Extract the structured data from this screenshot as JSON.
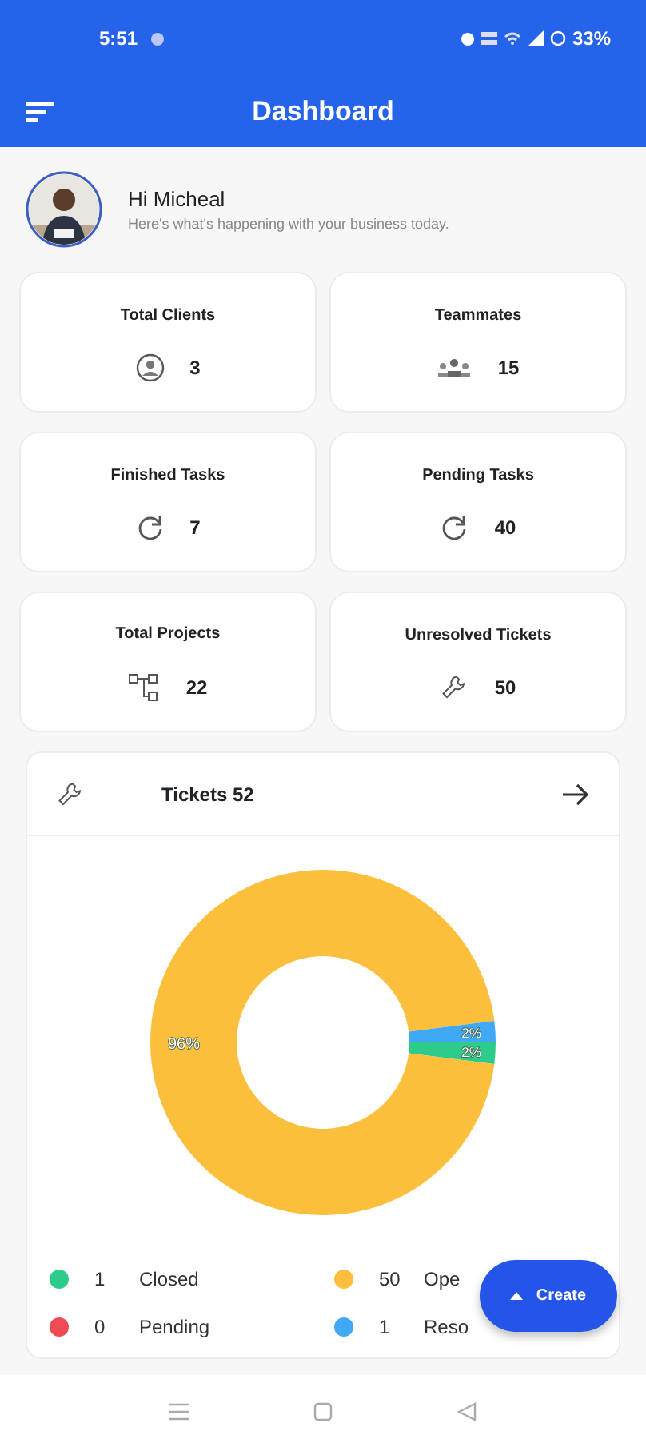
{
  "status_bar": {
    "time": "5:51",
    "battery": "33%"
  },
  "app_bar": {
    "title": "Dashboard"
  },
  "greeting": {
    "title": "Hi Micheal",
    "subtitle": "Here's what's happening with your business today."
  },
  "stats": [
    {
      "label": "Total Clients",
      "value": "3",
      "kind": "person"
    },
    {
      "label": "Teammates",
      "value": "15",
      "kind": "group"
    },
    {
      "label": "Finished Tasks",
      "value": "7",
      "kind": "refresh"
    },
    {
      "label": "Pending Tasks",
      "value": "40",
      "kind": "refresh"
    },
    {
      "label": "Total Projects",
      "value": "22",
      "kind": "tree"
    },
    {
      "label": "Unresolved Tickets",
      "value": "50",
      "kind": "wrench"
    }
  ],
  "tickets": {
    "title": "Tickets 52",
    "chart_data": {
      "type": "donut",
      "categories": [
        "Closed",
        "Ope",
        "Pending",
        "Reso"
      ],
      "series": [
        {
          "values": [
            2,
            96,
            0,
            2
          ]
        }
      ],
      "value_labels": [
        "2%",
        "96%",
        null,
        "2%"
      ]
    },
    "legend": [
      {
        "count": "1",
        "color": "#2ecc8a"
      },
      {
        "count": "50",
        "color": "#fbbf3c"
      },
      {
        "count": "0",
        "color": "#ef4b52"
      },
      {
        "count": "1",
        "color": "#3fa9f5"
      }
    ]
  },
  "fab": {
    "label": "Create"
  }
}
